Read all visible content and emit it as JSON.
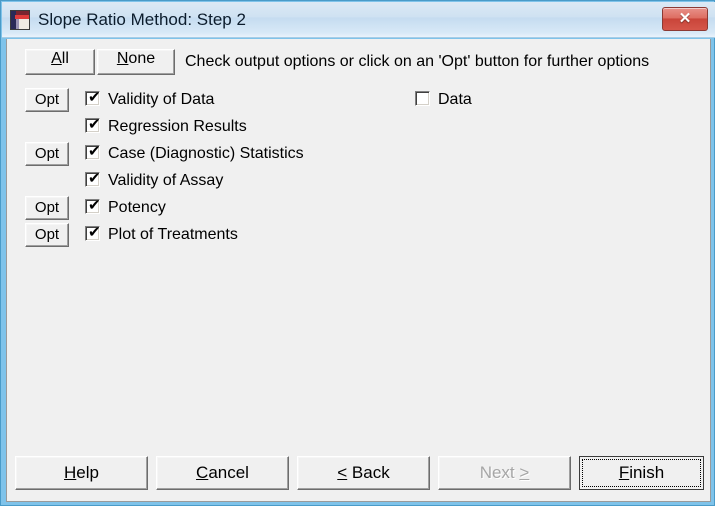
{
  "window": {
    "title": "Slope Ratio Method: Step 2",
    "icon": "app-chart-icon",
    "close_label": "✕",
    "colors": {
      "titlebar_top": "#dce9f5",
      "titlebar_bottom": "#eaf3fb",
      "aero_border": "#7fc3ea",
      "client_background": "#f0f0f0",
      "close_button": "#c9453a",
      "disabled_text": "#a6a6a6"
    }
  },
  "toolbar": {
    "all_label_before": "",
    "all_accel": "A",
    "all_label_after": "ll",
    "all_label": "All",
    "none_accel": "N",
    "none_label_after": "one",
    "none_label": "None",
    "hint": "Check output options or click on an 'Opt' button for further options"
  },
  "options": {
    "opt_button_label": "Opt",
    "rows": [
      {
        "label": "Validity of Data",
        "checked": true,
        "has_opt": true
      },
      {
        "label": "Regression Results",
        "checked": true,
        "has_opt": false
      },
      {
        "label": "Case (Diagnostic) Statistics",
        "checked": true,
        "has_opt": true
      },
      {
        "label": "Validity of Assay",
        "checked": true,
        "has_opt": false
      },
      {
        "label": "Potency",
        "checked": true,
        "has_opt": true
      },
      {
        "label": "Plot of Treatments",
        "checked": true,
        "has_opt": true
      }
    ],
    "right_column": {
      "label": "Data",
      "checked": false
    },
    "check_glyph": "✔"
  },
  "footer": {
    "buttons": [
      {
        "label": "Help",
        "accel": "H",
        "before": "",
        "after": "elp",
        "disabled": false,
        "default": false
      },
      {
        "label": "Cancel",
        "accel": "C",
        "before": "",
        "after": "ancel",
        "disabled": false,
        "default": false
      },
      {
        "label": "< Back",
        "accel": "<",
        "before": "",
        "after": " Back",
        "disabled": false,
        "default": false
      },
      {
        "label": "Next >",
        "accel": ">",
        "before": "Next ",
        "after": "",
        "disabled": true,
        "default": false
      },
      {
        "label": "Finish",
        "accel": "F",
        "before": "",
        "after": "inish",
        "disabled": false,
        "default": true
      }
    ]
  }
}
